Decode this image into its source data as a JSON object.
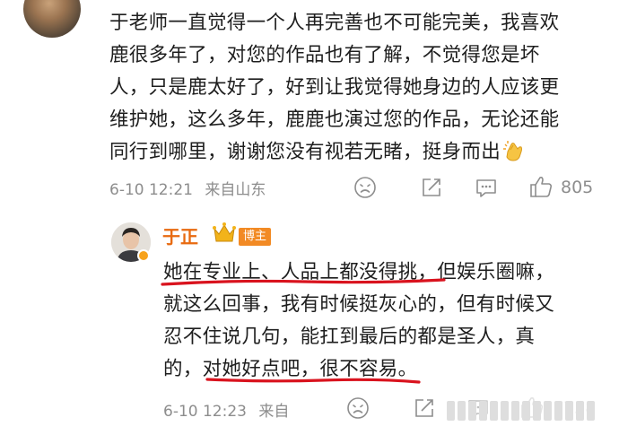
{
  "comment1": {
    "lines": [
      "于老师一直觉得一个人再完善也不可能完美，我喜欢",
      "鹿很多年了，对您的作品也有了解，不觉得您是坏",
      "人，只是鹿太好了，好到让我觉得她身边的人应该更",
      "维护她，这么多年，鹿鹿也演过您的作品，无论还能",
      "同行到哪里，谢谢您没有视若无睹，挺身而出"
    ],
    "time": "6-10 12:21",
    "location": "来自山东",
    "likes": "805"
  },
  "comment2": {
    "author": "于正",
    "badge": "博主",
    "lines": [
      "她在专业上、人品上都没得挑，但娱乐圈嘛，",
      "就这么回事，我有时候挺灰心的，但有时候又",
      "忍不住说几句，能扛到最后的都是圣人，真",
      "的，对她好点吧，很不容易。"
    ],
    "time": "6-10 12:23",
    "location": "来自",
    "likes": "1758"
  },
  "colors": {
    "author_name": "#e86a10",
    "badge_bg": "#f28a24",
    "underline": "#d9131e",
    "meta": "#8d8d8d"
  },
  "icons": [
    "avatar",
    "clap-emoji",
    "dislike-face-icon",
    "share-icon",
    "comment-icon",
    "like-thumb-icon",
    "crown-icon",
    "verified-badge-icon"
  ]
}
